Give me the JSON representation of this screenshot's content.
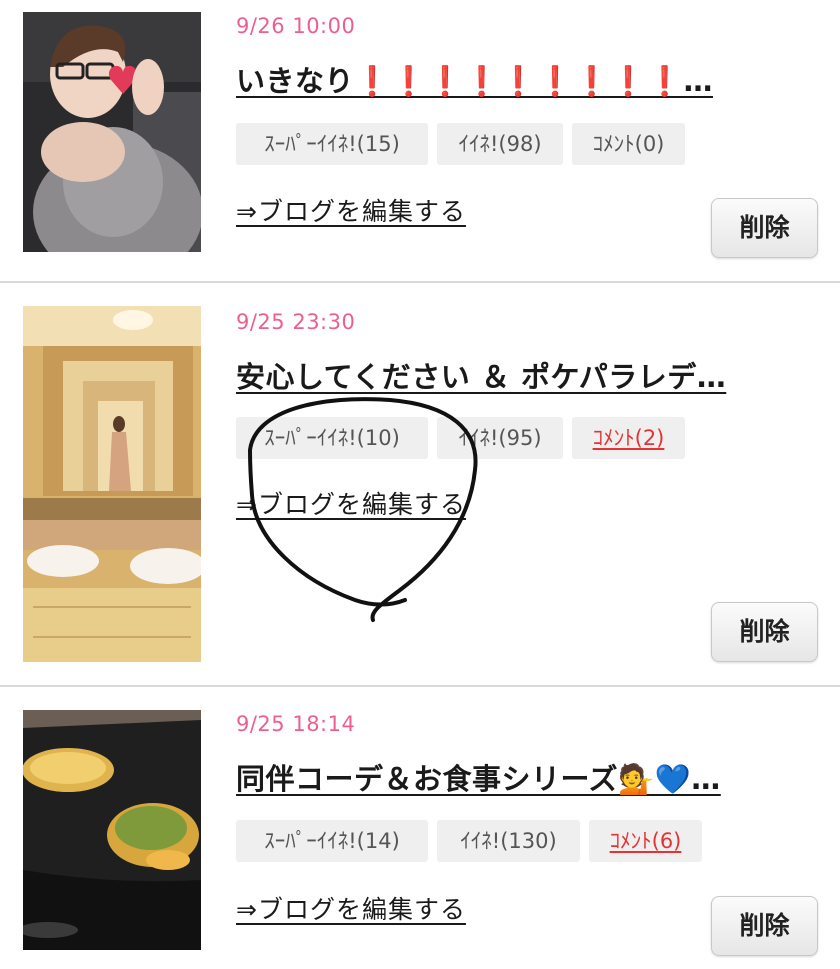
{
  "posts": [
    {
      "date": "9/26 10:00",
      "title": "いきなり❗❗❗❗❗❗❗❗❗…",
      "super_like": "ｽｰﾊﾟｰｲｲﾈ!(15)",
      "like": "ｲｲﾈ!(98)",
      "comment": "ｺﾒﾝﾄ(0)",
      "edit_link": "⇒ブログを編集する",
      "delete": "削除"
    },
    {
      "date": "9/25 23:30",
      "title": "安心してください ＆ ポケパラレデ…",
      "super_like": "ｽｰﾊﾟｰｲｲﾈ!(10)",
      "like": "ｲｲﾈ!(95)",
      "comment": "ｺﾒﾝﾄ(2)",
      "edit_link": "⇒ブログを編集する",
      "delete": "削除"
    },
    {
      "date": "9/25 18:14",
      "title": "同伴コーデ＆お食事シリーズ💁💙…",
      "super_like": "ｽｰﾊﾟｰｲｲﾈ!(14)",
      "like": "ｲｲﾈ!(130)",
      "comment": "ｺﾒﾝﾄ(6)",
      "edit_link": "⇒ブログを編集する",
      "delete": "削除"
    }
  ],
  "colors": {
    "date": "#ec5f8f",
    "comment_active": "#e53333",
    "badge_bg": "#efefef",
    "divider": "#d9d9d9"
  },
  "icons": [
    "exclamation-emoji",
    "person-tipping-hand-emoji",
    "blue-heart-emoji"
  ]
}
